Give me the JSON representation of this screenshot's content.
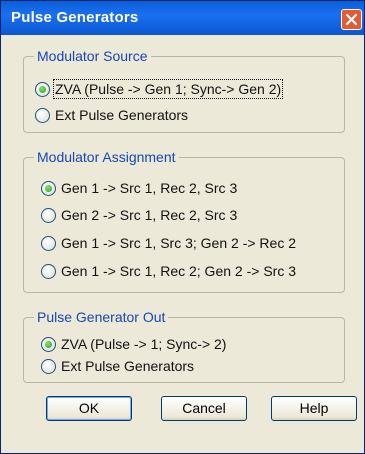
{
  "window": {
    "title": "Pulse Generators"
  },
  "groups": {
    "modulator_source": {
      "legend": "Modulator Source",
      "options": [
        {
          "label": "ZVA (Pulse -> Gen 1; Sync-> Gen 2)",
          "selected": true
        },
        {
          "label": "Ext Pulse Generators",
          "selected": false
        }
      ]
    },
    "modulator_assignment": {
      "legend": "Modulator Assignment",
      "options": [
        {
          "label": "Gen 1 -> Src 1, Rec 2, Src 3",
          "selected": true
        },
        {
          "label": "Gen 2 -> Src 1, Rec 2, Src 3",
          "selected": false
        },
        {
          "label": "Gen 1 -> Src 1, Src 3; Gen 2 -> Rec 2",
          "selected": false
        },
        {
          "label": "Gen 1 -> Src 1, Rec 2; Gen 2 -> Src 3",
          "selected": false
        }
      ]
    },
    "pulse_generator_out": {
      "legend": "Pulse Generator Out",
      "options": [
        {
          "label": "ZVA (Pulse -> 1; Sync-> 2)",
          "selected": true
        },
        {
          "label": "Ext Pulse Generators",
          "selected": false
        }
      ]
    }
  },
  "buttons": {
    "ok": "OK",
    "cancel": "Cancel",
    "help": "Help"
  },
  "colors": {
    "title_bar": "#0a5fd8",
    "legend_text": "#1646b8",
    "close_button": "#e35a34",
    "radio_selected": "#21a121"
  }
}
